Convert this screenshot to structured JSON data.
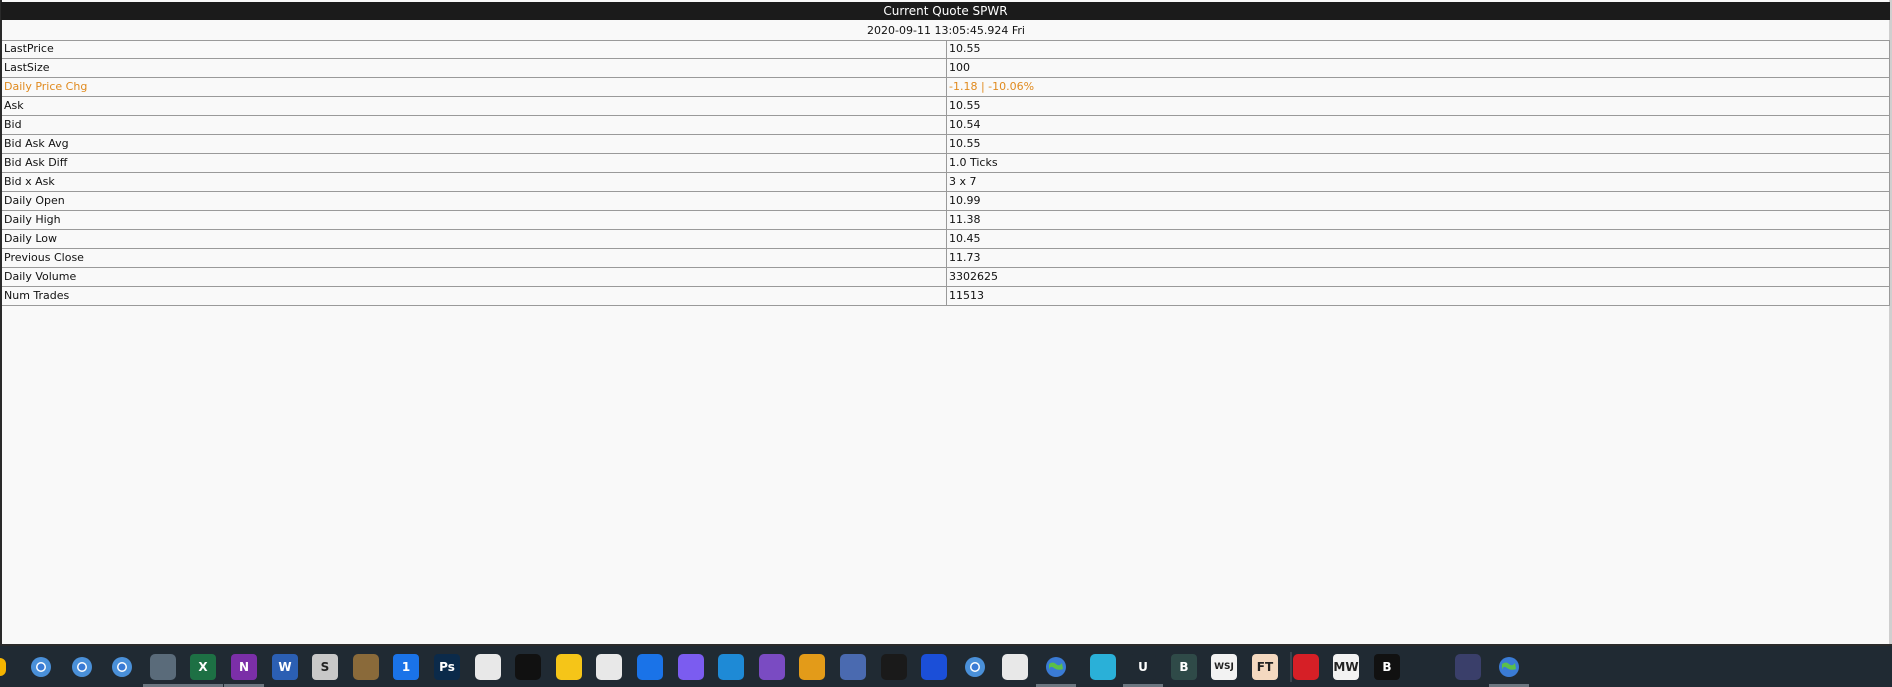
{
  "window": {
    "title": "Current Quote  SPWR",
    "timestamp": "2020-09-11  13:05:45.924 Fri"
  },
  "quote": {
    "rows": [
      {
        "label": "LastPrice",
        "value": "10.55"
      },
      {
        "label": "LastSize",
        "value": "100"
      },
      {
        "label": "Daily Price Chg",
        "value": "-1.18 | -10.06%",
        "highlight": true
      },
      {
        "label": "Ask",
        "value": "10.55"
      },
      {
        "label": "Bid",
        "value": "10.54"
      },
      {
        "label": "Bid Ask Avg",
        "value": "10.55"
      },
      {
        "label": "Bid Ask Diff",
        "value": "1.0 Ticks"
      },
      {
        "label": "Bid x Ask",
        "value": "3 x 7"
      },
      {
        "label": "Daily Open",
        "value": "10.99"
      },
      {
        "label": "Daily High",
        "value": "11.38"
      },
      {
        "label": "Daily Low",
        "value": "10.45"
      },
      {
        "label": "Previous Close",
        "value": "11.73"
      },
      {
        "label": "Daily Volume",
        "value": "3302625"
      },
      {
        "label": "Num Trades",
        "value": "11513"
      }
    ],
    "highlight_color": "#e08a1e"
  },
  "taskbar": {
    "icons": [
      {
        "name": "chrome-icon",
        "glyph": "",
        "color": "#4a90d9"
      },
      {
        "name": "chrome-icon",
        "glyph": "",
        "color": "#4a90d9"
      },
      {
        "name": "chrome-icon",
        "glyph": "",
        "color": "#4a90d9"
      },
      {
        "name": "calculator-icon",
        "glyph": "",
        "color": "#5a6b7a"
      },
      {
        "name": "excel-icon",
        "glyph": "X",
        "color": "#1d7044"
      },
      {
        "name": "onenote-icon",
        "glyph": "N",
        "color": "#7b2fa8"
      },
      {
        "name": "word-icon",
        "glyph": "W",
        "color": "#2b5fb3"
      },
      {
        "name": "scrivener-icon",
        "glyph": "S",
        "color": "#c8c8c8"
      },
      {
        "name": "books-icon",
        "glyph": "",
        "color": "#8a6a3a"
      },
      {
        "name": "onepassword-icon",
        "glyph": "1",
        "color": "#1a73e8"
      },
      {
        "name": "photoshop-icon",
        "glyph": "Ps",
        "color": "#0b2a4a"
      },
      {
        "name": "cat-icon",
        "glyph": "",
        "color": "#e8e8e8"
      },
      {
        "name": "tidal-icon",
        "glyph": "",
        "color": "#111111"
      },
      {
        "name": "player-icon",
        "glyph": "",
        "color": "#f5c518"
      },
      {
        "name": "slack-icon",
        "glyph": "",
        "color": "#e8e8e8"
      },
      {
        "name": "maps-icon",
        "glyph": "",
        "color": "#1a73e8"
      },
      {
        "name": "clickup-icon",
        "glyph": "",
        "color": "#7b5cf0"
      },
      {
        "name": "vscode-icon",
        "glyph": "",
        "color": "#1e8ad6"
      },
      {
        "name": "visualstudio-icon",
        "glyph": "",
        "color": "#7a4bc2"
      },
      {
        "name": "window-icon",
        "glyph": "",
        "color": "#e39b19"
      },
      {
        "name": "network-icon",
        "glyph": "",
        "color": "#4a6ab0"
      },
      {
        "name": "ryzen-icon",
        "glyph": "",
        "color": "#1a1a1a"
      },
      {
        "name": "malwarebytes-icon",
        "glyph": "",
        "color": "#1b4fd8"
      },
      {
        "name": "chrome-icon",
        "glyph": "",
        "color": "#4a90d9"
      },
      {
        "name": "acrobat-icon",
        "glyph": "",
        "color": "#e8e8e8"
      },
      {
        "name": "globe-icon",
        "glyph": "",
        "color": "#3fa34d"
      },
      {
        "name": "arrow-app-icon",
        "glyph": "",
        "color": "#2ab0d8"
      },
      {
        "name": "u-app-icon",
        "glyph": "U",
        "color": "#202a33"
      },
      {
        "name": "b-app-icon",
        "glyph": "B",
        "color": "#2f4a48"
      },
      {
        "name": "wsj-icon",
        "glyph": "WSJ",
        "color": "#f2f2f2"
      },
      {
        "name": "ft-icon",
        "glyph": "FT",
        "color": "#f4d9c0"
      },
      {
        "name": "economist-icon",
        "glyph": "",
        "color": "#d61f26"
      },
      {
        "name": "marketwatch-icon",
        "glyph": "MW",
        "color": "#f2f2f2"
      },
      {
        "name": "bloomberg-icon",
        "glyph": "B",
        "color": "#111111"
      },
      {
        "name": "nbc-icon",
        "glyph": "",
        "color": "#202a33"
      },
      {
        "name": "vpn-icon",
        "glyph": "",
        "color": "#3a3f6a"
      },
      {
        "name": "globe-icon",
        "glyph": "",
        "color": "#3fa34d"
      }
    ]
  }
}
